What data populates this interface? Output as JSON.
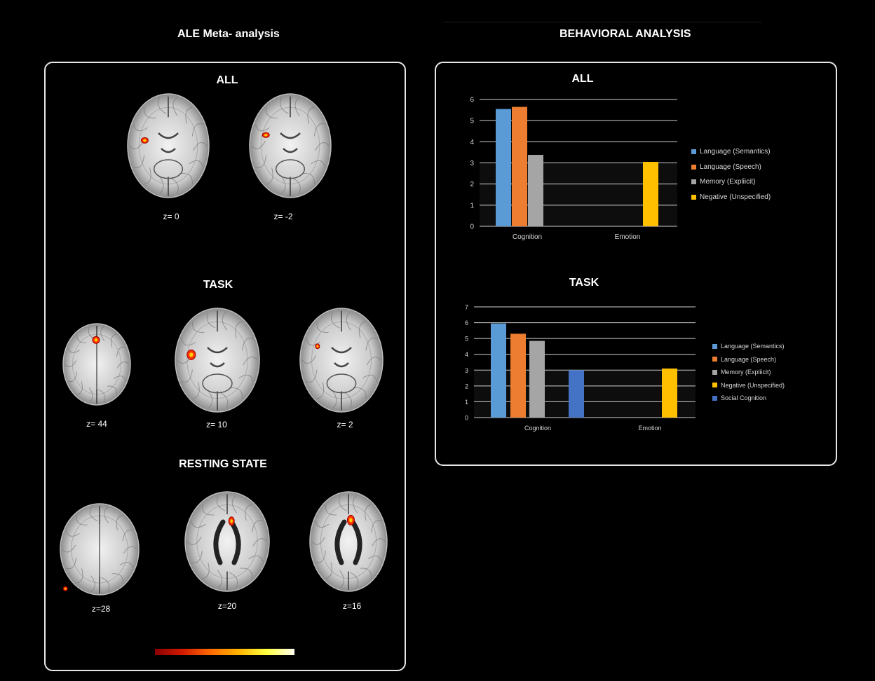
{
  "headings": {
    "left": "ALE Meta- analysis",
    "right": "BEHAVIORAL ANALYSIS"
  },
  "left_panel": {
    "all_title": "ALL",
    "task_title": "TASK",
    "rest_title": "RESTING STATE",
    "labels": {
      "all_1": "z= 0",
      "all_2": "z= -2",
      "task_1": "z= 44",
      "task_2": "z= 10",
      "task_3": "z= 2",
      "rest_1": "z=28",
      "rest_2": "z=20",
      "rest_3": "z=16"
    }
  },
  "colors": {
    "lang_sem": "#5b9bd5",
    "lang_speech": "#ed7d31",
    "memory": "#a5a5a5",
    "negative": "#ffc000",
    "social": "#4472c4",
    "activation": "#ff3300"
  },
  "chart_data": [
    {
      "type": "bar",
      "title": "ALL",
      "categories": [
        "Cognition",
        "Emotion"
      ],
      "ylim": [
        0,
        6
      ],
      "yticks": [
        0,
        1,
        2,
        3,
        4,
        5,
        6
      ],
      "grid": true,
      "legend_position": "right",
      "series": [
        {
          "name": "Language (Semantics)",
          "color": "#5b9bd5",
          "values": [
            5.55,
            null
          ]
        },
        {
          "name": "Language (Speech)",
          "color": "#ed7d31",
          "values": [
            5.65,
            null
          ]
        },
        {
          "name": "Memory (Expliicit)",
          "color": "#a5a5a5",
          "values": [
            3.38,
            null
          ]
        },
        {
          "name": "Negative (Unspecified)",
          "color": "#ffc000",
          "values": [
            null,
            3.05
          ]
        }
      ]
    },
    {
      "type": "bar",
      "title": "TASK",
      "categories": [
        "Cognition",
        "Emotion"
      ],
      "ylim": [
        0,
        7
      ],
      "yticks": [
        0,
        1,
        2,
        3,
        4,
        5,
        6,
        7
      ],
      "grid": true,
      "legend_position": "right",
      "series": [
        {
          "name": "Language (Semantics)",
          "color": "#5b9bd5",
          "values": [
            5.95,
            null
          ]
        },
        {
          "name": "Language (Speech)",
          "color": "#ed7d31",
          "values": [
            5.3,
            null
          ]
        },
        {
          "name": "Memory (Expliicit)",
          "color": "#a5a5a5",
          "values": [
            4.85,
            null
          ]
        },
        {
          "name": "Negative (Unspecified)",
          "color": "#ffc000",
          "values": [
            null,
            3.1
          ]
        },
        {
          "name": "Social Cognition",
          "color": "#4472c4",
          "values": [
            3.0,
            null
          ]
        }
      ]
    }
  ]
}
